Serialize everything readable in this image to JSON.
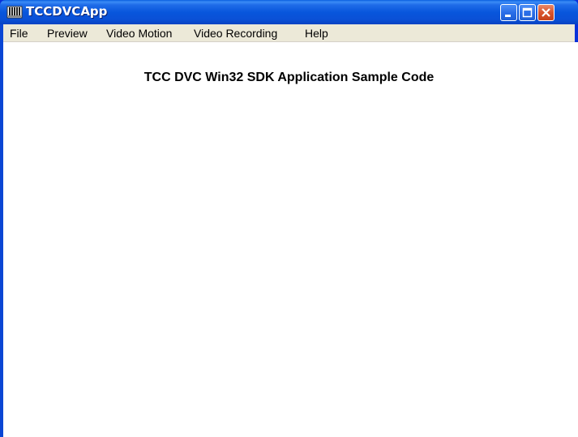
{
  "window": {
    "title": "TCCDVCApp",
    "app_icon": "film-strip-icon",
    "controls": {
      "minimize_icon": "minimize-icon",
      "maximize_icon": "maximize-icon",
      "close_icon": "close-icon"
    }
  },
  "menubar": {
    "items": [
      {
        "label": "File"
      },
      {
        "label": "Preview"
      },
      {
        "label": "Video Motion"
      },
      {
        "label": "Video Recording"
      },
      {
        "label": "Help"
      }
    ]
  },
  "content": {
    "heading": "TCC DVC Win32 SDK Application Sample Code"
  },
  "colors": {
    "titlebar_blue": "#0a50d6",
    "menubar_bg": "#ece9d8",
    "close_red": "#d9542c",
    "client_bg": "#ffffff"
  }
}
